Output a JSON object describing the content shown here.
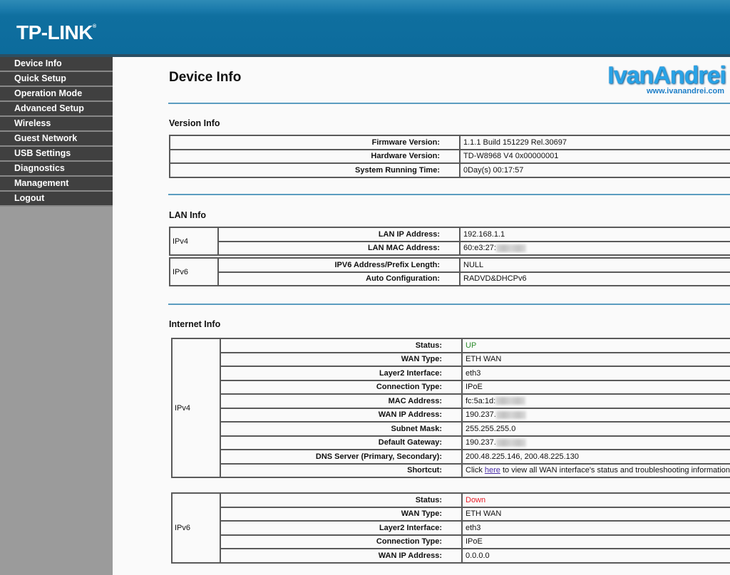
{
  "header": {
    "logo": "TP-LINK",
    "logo_mark": "®"
  },
  "sidebar": {
    "items": [
      {
        "label": "Device Info"
      },
      {
        "label": "Quick Setup"
      },
      {
        "label": "Operation Mode"
      },
      {
        "label": "Advanced Setup"
      },
      {
        "label": "Wireless"
      },
      {
        "label": "Guest Network"
      },
      {
        "label": "USB Settings"
      },
      {
        "label": "Diagnostics"
      },
      {
        "label": "Management"
      },
      {
        "label": "Logout"
      }
    ]
  },
  "main": {
    "title": "Device Info",
    "watermark": {
      "name": "IvanAndrei",
      "url": "www.ivanandrei.com"
    },
    "version_info": {
      "title": "Version Info",
      "rows": [
        {
          "label": "Firmware Version:",
          "value": "1.1.1 Build 151229 Rel.30697"
        },
        {
          "label": "Hardware Version:",
          "value": "TD-W8968 V4 0x00000001"
        },
        {
          "label": "System Running Time:",
          "value": "0Day(s) 00:17:57"
        }
      ]
    },
    "lan_info": {
      "title": "LAN Info",
      "ipv4": {
        "group": "IPv4",
        "rows": [
          {
            "label": "LAN IP Address:",
            "value": "192.168.1.1"
          },
          {
            "label": "LAN MAC Address:",
            "value": "60:e3:27:",
            "redacted": true
          }
        ]
      },
      "ipv6": {
        "group": "IPv6",
        "rows": [
          {
            "label": "IPV6 Address/Prefix Length:",
            "value": "NULL"
          },
          {
            "label": "Auto Configuration:",
            "value": "RADVD&DHCPv6"
          }
        ]
      }
    },
    "internet_info": {
      "title": "Internet Info",
      "ipv4": {
        "group": "IPv4",
        "rows": [
          {
            "label": "Status:",
            "value": "UP",
            "color": "#2b8a2b"
          },
          {
            "label": "WAN Type:",
            "value": "ETH WAN"
          },
          {
            "label": "Layer2 Interface:",
            "value": "eth3"
          },
          {
            "label": "Connection Type:",
            "value": "IPoE"
          },
          {
            "label": "MAC Address:",
            "value": "fc:5a:1d:",
            "redacted": true
          },
          {
            "label": "WAN IP Address:",
            "value": "190.237.",
            "redacted": true
          },
          {
            "label": "Subnet Mask:",
            "value": "255.255.255.0"
          },
          {
            "label": "Default Gateway:",
            "value": "190.237.",
            "redacted": true
          },
          {
            "label": "DNS Server (Primary, Secondary):",
            "value": "200.48.225.146, 200.48.225.130"
          },
          {
            "label": "Shortcut:",
            "value_prefix": "Click ",
            "link": "here",
            "value_suffix": " to view all WAN interface's status and troubleshooting information."
          }
        ]
      },
      "ipv6": {
        "group": "IPv6",
        "rows": [
          {
            "label": "Status:",
            "value": "Down",
            "color": "#e8202a"
          },
          {
            "label": "WAN Type:",
            "value": "ETH WAN"
          },
          {
            "label": "Layer2 Interface:",
            "value": "eth3"
          },
          {
            "label": "Connection Type:",
            "value": "IPoE"
          },
          {
            "label": "WAN IP Address:",
            "value": "0.0.0.0"
          }
        ]
      }
    }
  }
}
